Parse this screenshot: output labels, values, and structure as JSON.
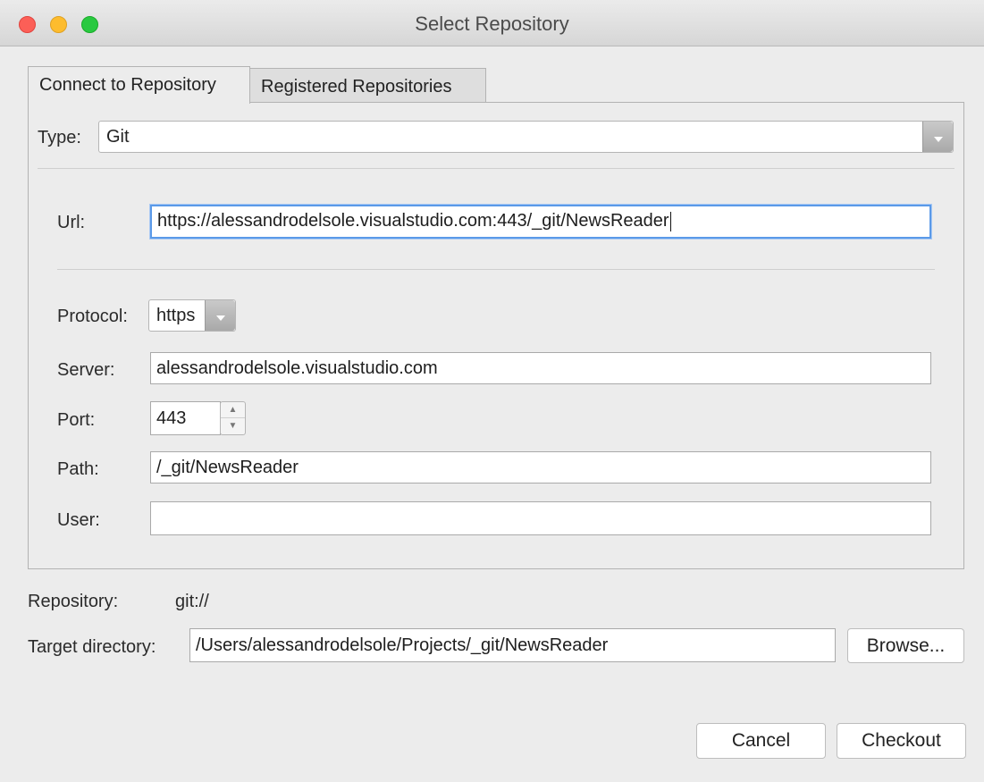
{
  "window": {
    "title": "Select Repository"
  },
  "tabs": [
    {
      "label": "Connect to Repository"
    },
    {
      "label": "Registered Repositories"
    }
  ],
  "form": {
    "type_label": "Type:",
    "type_value": "Git",
    "url_label": "Url:",
    "url_value": "https://alessandrodelsole.visualstudio.com:443/_git/NewsReader",
    "protocol_label": "Protocol:",
    "protocol_value": "https",
    "server_label": "Server:",
    "server_value": "alessandrodelsole.visualstudio.com",
    "port_label": "Port:",
    "port_value": "443",
    "path_label": "Path:",
    "path_value": "/_git/NewsReader",
    "user_label": "User:",
    "user_value": ""
  },
  "footer": {
    "repository_label": "Repository:",
    "repository_value": "git://",
    "target_label": "Target directory:",
    "target_value": "/Users/alessandrodelsole/Projects/_git/NewsReader",
    "browse_label": "Browse...",
    "cancel_label": "Cancel",
    "checkout_label": "Checkout"
  },
  "icons": [
    "close-light",
    "minimize-light",
    "zoom-light",
    "dropdown-arrow",
    "stepper-up",
    "stepper-down"
  ],
  "colors": {
    "focus_border": "#5b9ae8",
    "close": "#fc5f57",
    "minimize": "#fdbc2e",
    "zoom": "#29c940"
  }
}
